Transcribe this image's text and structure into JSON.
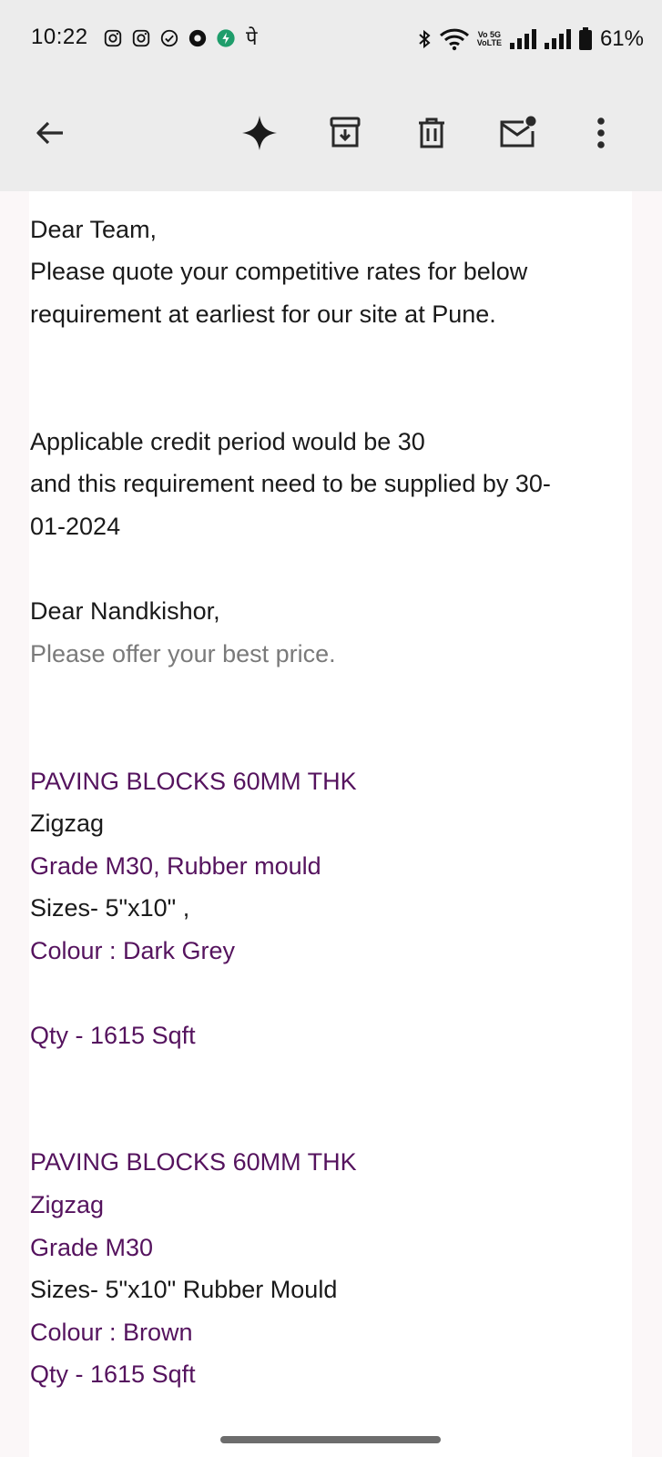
{
  "status_bar": {
    "time": "10:22",
    "network_label_top": "Vo 5G",
    "network_label_bottom": "VoLTE",
    "battery": "61%"
  },
  "app_bar": {
    "icons": [
      "back-arrow-icon",
      "sparkle-icon",
      "archive-icon",
      "trash-icon",
      "mark-unread-icon",
      "more-vert-icon"
    ]
  },
  "email": {
    "greeting": "Dear Team,",
    "para1_line1": "Please quote your competitive rates for below",
    "para1_line2": "requirement at earliest for our site at Pune.",
    "credit_line1": "Applicable credit period would be 30",
    "credit_line2": "and this requirement need to be supplied by 30-",
    "credit_line3": "01-2024",
    "greeting2": "Dear Nandkishor,",
    "request": "Please offer your best price.",
    "item1": {
      "title": "PAVING BLOCKS 60MM THK",
      "pattern": "Zigzag",
      "grade": "Grade M30, Rubber mould",
      "sizes": "Sizes- 5\"x10\" ,",
      "colour": "Colour : Dark Grey",
      "qty": "Qty - 1615 Sqft"
    },
    "item2": {
      "title": "PAVING BLOCKS 60MM THK",
      "pattern": "Zigzag",
      "grade": "Grade M30",
      "sizes": "Sizes- 5\"x10\" Rubber Mould",
      "colour": "Colour : Brown",
      "qty": "Qty - 1615 Sqft"
    }
  },
  "colors": {
    "text": "#1a1a1a",
    "quoted_purple": "#55135e",
    "muted_gray": "#7a7a7a",
    "bar_bg": "#ececec"
  }
}
